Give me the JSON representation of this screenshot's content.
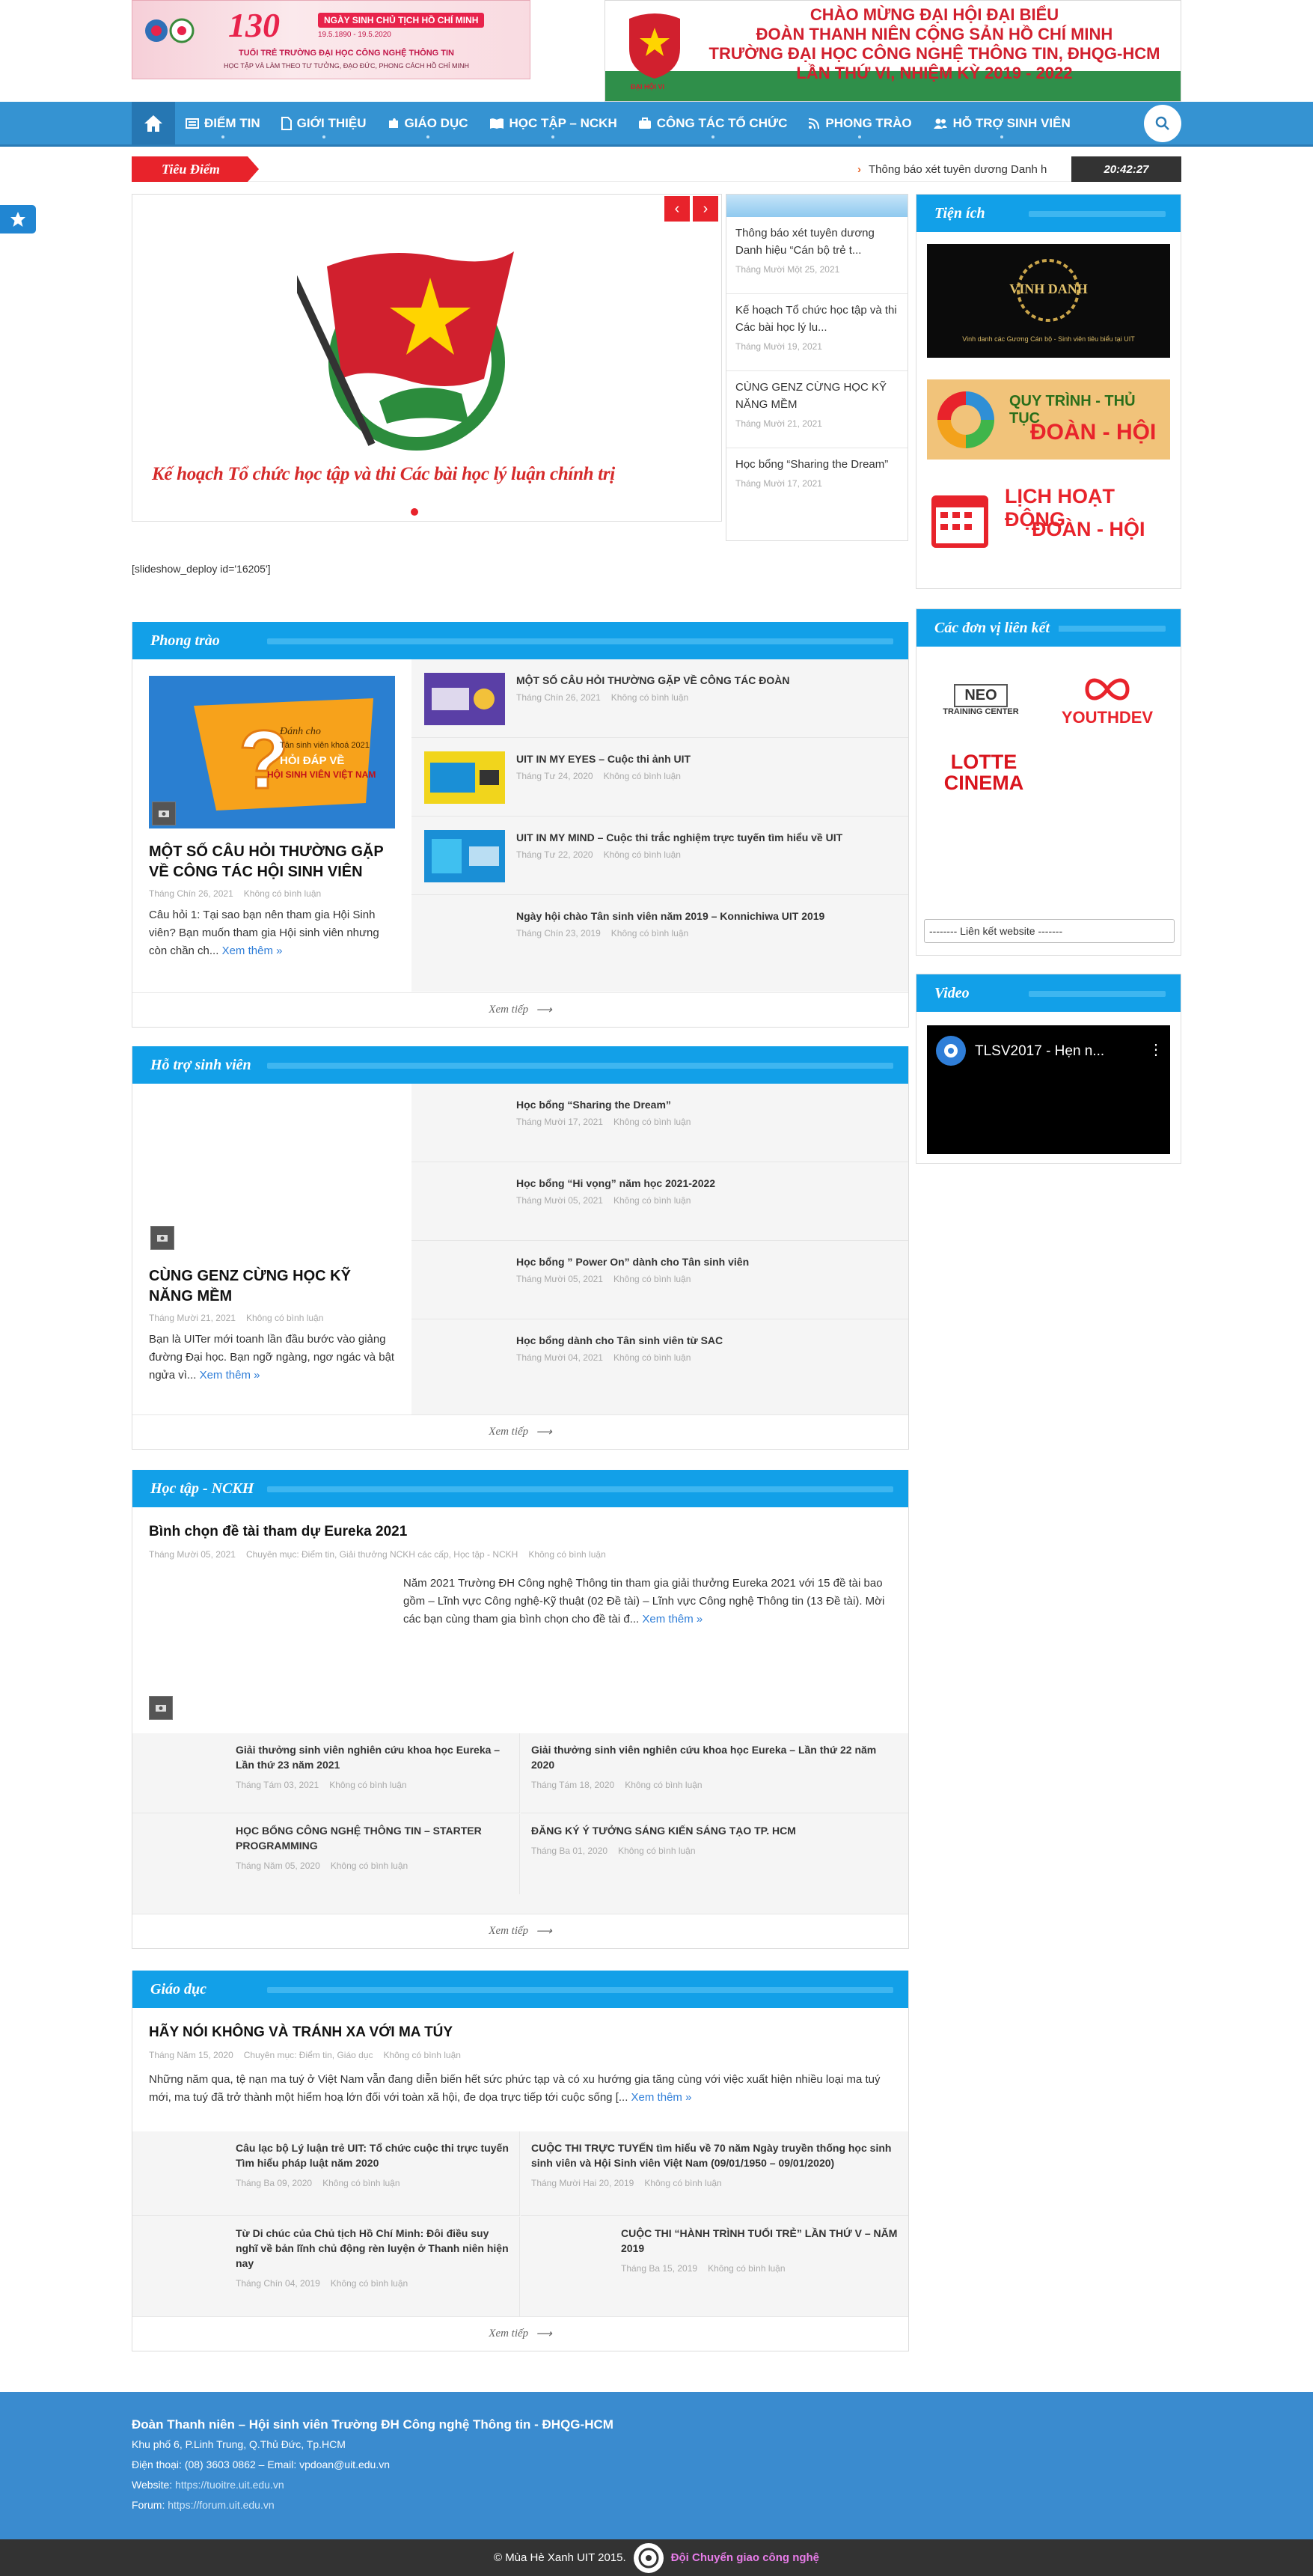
{
  "banner_left": {
    "number": "130",
    "title": "NGÀY SINH CHỦ TỊCH HỒ CHÍ MINH",
    "dates": "19.5.1890 - 19.5.2020",
    "line1": "TUỔI TRẺ TRƯỜNG ĐẠI HỌC CÔNG NGHỆ THÔNG TIN",
    "line2": "HỌC TẬP VÀ LÀM THEO TƯ TƯỞNG, ĐẠO ĐỨC, PHONG CÁCH HỒ CHÍ MINH"
  },
  "banner_right": {
    "lines": [
      "CHÀO MỪNG ĐẠI HỘI ĐẠI BIỂU",
      "ĐOÀN THANH NIÊN CỘNG SẢN HỒ CHÍ MINH",
      "TRƯỜNG ĐẠI HỌC CÔNG NGHỆ THÔNG TIN, ĐHQG-HCM",
      "LẦN THỨ VI, NHIỆM KỲ 2019 - 2022"
    ],
    "foot": "ĐẠI HỘI VI"
  },
  "nav": {
    "items": [
      "ĐIỂM TIN",
      "GIỚI THIỆU",
      "GIÁO DỤC",
      "HỌC TẬP – NCKH",
      "CÔNG TÁC TỔ CHỨC",
      "PHONG TRÀO",
      "HỖ TRỢ SINH VIÊN"
    ],
    "icons": [
      "home-icon",
      "newspaper-icon",
      "file-icon",
      "puzzle-icon",
      "book-icon",
      "briefcase-icon",
      "rss-icon",
      "users-icon",
      "search-icon"
    ]
  },
  "ticker": {
    "label": "Tiêu Điểm",
    "text": "Thông báo xét tuyên dương Danh h",
    "time": "20:42:27"
  },
  "slider": {
    "caption": "Kế hoạch Tổ chức học tập và thi Các bài học lý luận chính trị",
    "prev": "‹",
    "next": "›"
  },
  "slide_list": [
    {
      "title": "Thông báo xét tuyên dương Danh hiệu “Cán bộ trẻ t...",
      "date": "Tháng Mười Một 25, 2021"
    },
    {
      "title": "Kế hoạch Tổ chức học tập và thi Các bài học lý lu...",
      "date": "Tháng Mười 19, 2021"
    },
    {
      "title": "CÙNG GENZ CỪNG HỌC KỸ NĂNG MỀM",
      "date": "Tháng Mười 21, 2021"
    },
    {
      "title": "Học bổng “Sharing the Dream”",
      "date": "Tháng Mười 17, 2021"
    }
  ],
  "shortcode": "[slideshow_deploy id='16205']",
  "no_comment": "Không có bình luận",
  "read_more": "Xem thêm »",
  "more_label": "Xem tiếp",
  "phong_trao": {
    "heading": "Phong trào",
    "featured": {
      "title": "MỘT SỐ CÂU HỎI THƯỜNG GẶP VỀ CÔNG TÁC HỘI SINH VIÊN",
      "date": "Tháng Chín 26, 2021",
      "excerpt": "Câu hỏi 1: Tại sao bạn nên tham gia Hội Sinh viên? Bạn muốn tham gia Hội sinh viên nhưng còn chần ch...",
      "img_l1": "Đánh cho",
      "img_l2": "Tân sinh viên khoá 2021",
      "img_l3": "HỎI ĐÁP VỀ",
      "img_l4": "HỘI SINH VIÊN VIỆT NAM"
    },
    "items": [
      {
        "title": "MỘT SỐ CÂU HỎI THƯỜNG GẶP VỀ CÔNG TÁC ĐOÀN",
        "date": "Tháng Chín 26, 2021"
      },
      {
        "title": "UIT IN MY EYES – Cuộc thi ảnh UIT",
        "date": "Tháng Tư 24, 2020"
      },
      {
        "title": "UIT IN MY MIND – Cuộc thi trắc nghiệm trực tuyến tìm hiểu về UIT",
        "date": "Tháng Tư 22, 2020"
      },
      {
        "title": "Ngày hội chào Tân sinh viên năm 2019 – Konnichiwa UIT 2019",
        "date": "Tháng Chín 23, 2019"
      }
    ]
  },
  "ho_tro": {
    "heading": "Hỗ trợ sinh viên",
    "featured": {
      "title": "CÙNG GENZ CỪNG HỌC KỸ NĂNG MỀM",
      "date": "Tháng Mười 21, 2021",
      "excerpt": "Bạn là UITer mới toanh lần đầu bước vào giảng đường Đại học. Bạn ngỡ ngàng, ngơ ngác và bật ngửa vì..."
    },
    "items": [
      {
        "title": "Học bổng “Sharing the Dream”",
        "date": "Tháng Mười 17, 2021"
      },
      {
        "title": "Học bổng “Hi vọng” năm học 2021-2022",
        "date": "Tháng Mười 05, 2021"
      },
      {
        "title": "Học bổng ” Power On” dành cho Tân sinh viên",
        "date": "Tháng Mười 05, 2021"
      },
      {
        "title": "Học bổng dành cho Tân sinh viên từ SAC",
        "date": "Tháng Mười 04, 2021"
      }
    ]
  },
  "hoc_tap": {
    "heading": "Học tập - NCKH",
    "featured": {
      "title": "Bình chọn đề tài tham dự Eureka 2021",
      "date": "Tháng Mười 05, 2021",
      "category": "Chuyên mục: Điểm tin, Giải thưởng NCKH các cấp, Học tập - NCKH",
      "excerpt": "Năm 2021 Trường ĐH Công nghệ Thông tin tham gia giải thưởng Eureka 2021 với 15 đề tài bao gồm – Lĩnh vực Công nghệ-Kỹ thuật (02 Đề tài) – Lĩnh vực Công nghệ Thông tin (13 Đề tài). Mời các bạn cùng tham gia bình chọn cho đề tài đ..."
    },
    "items": [
      {
        "title": "Giải thưởng sinh viên nghiên cứu khoa học Eureka – Lần thứ 23 năm 2021",
        "date": "Tháng Tám 03, 2021"
      },
      {
        "title": "Giải thưởng sinh viên nghiên cứu khoa học Eureka – Lần thứ 22 năm 2020",
        "date": "Tháng Tám 18, 2020"
      },
      {
        "title": "HỌC BỔNG CÔNG NGHỆ THÔNG TIN – STARTER PROGRAMMING",
        "date": "Tháng Năm 05, 2020"
      },
      {
        "title": "ĐĂNG KÝ Ý TƯỞNG SÁNG KIẾN SÁNG TẠO TP. HCM",
        "date": "Tháng Ba 01, 2020"
      }
    ]
  },
  "giao_duc": {
    "heading": "Giáo dục",
    "featured": {
      "title": "HÃY NÓI KHÔNG VÀ TRÁNH XA VỚI MA TÚY",
      "date": "Tháng Năm 15, 2020",
      "category": "Chuyên mục: Điểm tin, Giáo dục",
      "excerpt": "Những năm qua, tệ nạn ma tuý ở Việt Nam vẫn đang diễn biến hết sức phức tạp và có xu hướng gia tăng cùng với việc xuất hiện nhiều loại ma tuý mới, ma tuý đã trở thành một hiểm hoạ lớn đối với toàn xã hội, đe dọa trực tiếp tới cuộc sống [..."
    },
    "items": [
      {
        "title": "Câu lạc bộ Lý luận trẻ UIT: Tổ chức cuộc thi trực tuyến Tìm hiểu pháp luật năm 2020",
        "date": "Tháng Ba 09, 2020"
      },
      {
        "title": "CUỘC THI TRỰC TUYẾN tìm hiểu về 70 năm Ngày truyền thống học sinh sinh viên và Hội Sinh viên Việt Nam (09/01/1950 – 09/01/2020)",
        "date": "Tháng Mười Hai 20, 2019"
      },
      {
        "title": "Từ Di chúc của Chủ tịch Hồ Chí Minh: Đôi điều suy nghĩ về bản lĩnh chủ động rèn luyện ở Thanh niên hiện nay",
        "date": "Tháng Chín 04, 2019"
      },
      {
        "title": "CUỘC THI “HÀNH TRÌNH TUỔI TRẺ” LẦN THỨ V – NĂM 2019",
        "date": "Tháng Ba 15, 2019"
      }
    ]
  },
  "tien_ich": {
    "heading": "Tiện ích",
    "vinh_danh": "VINH DANH",
    "vinh_danh_sub": "Vinh danh các Gương Cán bộ - Sinh viên tiêu biểu tại UIT",
    "quy_trinh": "QUY TRÌNH - THỦ TỤC",
    "doan_hoi": "ĐOÀN - HỘI",
    "lich": "LỊCH HOẠT ĐỘNG",
    "lich2": "ĐOÀN - HỘI"
  },
  "lien_ket": {
    "heading": "Các đơn vị liên kết",
    "neo": "NEO",
    "neo_sub": "TRAINING CENTER",
    "youthdev": "YOUTHDEV",
    "lotte1": "LOTTE",
    "lotte2": "CINEMA",
    "select": "-------- Liên kết website -------"
  },
  "video": {
    "heading": "Video",
    "title": "TLSV2017 - Hẹn n..."
  },
  "footer": {
    "title": "Đoàn Thanh niên – Hội sinh viên Trường ĐH Công nghệ Thông tin - ĐHQG-HCM",
    "address": "Khu phố 6, P.Linh Trung, Q.Thủ Đức, Tp.HCM",
    "phone": "Điện thoại: (08) 3603 0862 – Email: vpdoan@uit.edu.vn",
    "website_label": "Website:",
    "website": "https://tuoitre.uit.edu.vn",
    "forum_label": "Forum:",
    "forum": "https://forum.uit.edu.vn"
  },
  "copyright": {
    "text": "© Mùa Hè Xanh UIT 2015.",
    "team": "Đội Chuyển giao công nghệ"
  },
  "colors": {
    "nav": "#3593d2",
    "section_head": "#12a0e8",
    "accent_red": "#e8232b",
    "footer": "#3a8bcf"
  }
}
